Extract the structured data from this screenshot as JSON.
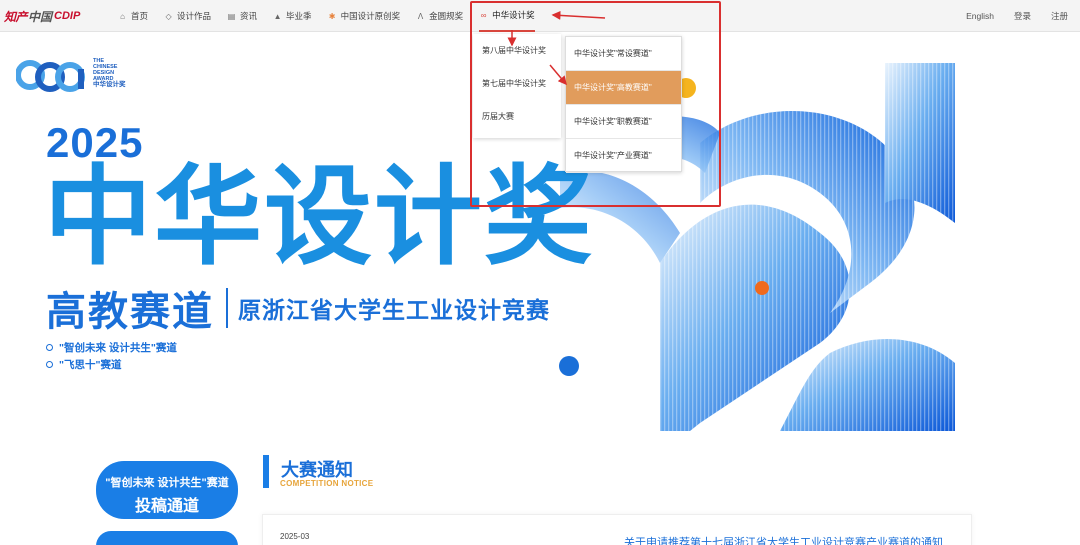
{
  "logo": {
    "part1": "知产",
    "part2": "中国",
    "part3": "CDIP"
  },
  "nav": {
    "items": [
      {
        "label": "首页",
        "icon": "home-icon",
        "glyph": "⌂"
      },
      {
        "label": "设计作品",
        "icon": "diamond-icon",
        "glyph": "◇"
      },
      {
        "label": "资讯",
        "icon": "news-icon",
        "glyph": "▤"
      },
      {
        "label": "毕业季",
        "icon": "graduation-cap-icon",
        "glyph": "▲"
      },
      {
        "label": "中国设计原创奖",
        "icon": "award-icon",
        "glyph": "✱"
      },
      {
        "label": "金圆规奖",
        "icon": "compass-icon",
        "glyph": "Λ"
      },
      {
        "label": "中华设计奖",
        "icon": "link-icon",
        "glyph": "∞"
      }
    ],
    "right": [
      "English",
      "登录",
      "注册"
    ]
  },
  "dropdown": {
    "level1": [
      "第八届中华设计奖",
      "第七届中华设计奖",
      "历届大赛"
    ],
    "level2": [
      "中华设计奖\"常设赛道\"",
      "中华设计奖\"高教赛道\"",
      "中华设计奖\"职教赛道\"",
      "中华设计奖\"产业赛道\""
    ],
    "selected_level2": "中华设计奖\"高教赛道\""
  },
  "hero": {
    "logo_en": [
      "THE",
      "CHINESE",
      "DESIGN",
      "AWARD"
    ],
    "logo_cn": "中华设计奖",
    "year": "2025",
    "title": "中华设计奖",
    "subtitle_left": "高教赛道",
    "subtitle_right": "原浙江省大学生工业设计竞赛",
    "tracks": [
      "\"智创未来 设计共生\"赛道",
      "\"飞思十\"赛道"
    ]
  },
  "sidebar_buttons": {
    "submit_line1": "\"智创未来 设计共生\"赛道",
    "submit_line2": "投稿通道"
  },
  "notice": {
    "title": "大赛通知",
    "subtitle": "COMPETITION NOTICE",
    "date": "2025-03",
    "first_item": "关于申请推荐第十七届浙江省大学生工业设计竞赛产业赛道的通知"
  },
  "colors": {
    "brand_blue": "#1a8fe0",
    "dark_blue": "#1a6fd8",
    "highlight_orange": "#e19c5c",
    "annotation_red": "#d92f2f",
    "accent_yellow": "#f5b41e"
  }
}
